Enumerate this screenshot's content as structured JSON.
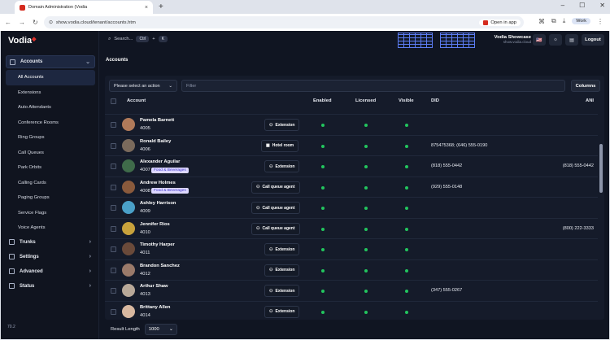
{
  "browser": {
    "tab_title": "Domain Administration (Vodia",
    "url": "show.vodia.cloud/tenant/accounts.htm",
    "open_in_app": "Open in app",
    "profile": "Work"
  },
  "sidebar": {
    "logo": "Vodia",
    "version": "70.2",
    "sections": [
      {
        "label": "Accounts"
      },
      {
        "label": "Trunks"
      },
      {
        "label": "Settings"
      },
      {
        "label": "Advanced"
      },
      {
        "label": "Status"
      }
    ],
    "items": [
      {
        "label": "All Accounts"
      },
      {
        "label": "Extensions"
      },
      {
        "label": "Auto Attendants"
      },
      {
        "label": "Conference Rooms"
      },
      {
        "label": "Ring Groups"
      },
      {
        "label": "Call Queues"
      },
      {
        "label": "Park Orbits"
      },
      {
        "label": "Calling Cards"
      },
      {
        "label": "Paging Groups"
      },
      {
        "label": "Service Flags"
      },
      {
        "label": "Voice Agents"
      }
    ]
  },
  "topbar": {
    "search_label": "Search...",
    "kbd1": "Ctrl",
    "kbd_plus": "+",
    "kbd2": "K",
    "brand": "Vodia Showcase",
    "brand_sub": "show.vodia.cloud",
    "logout": "Logout"
  },
  "page": {
    "title": "Accounts",
    "action_select": "Please select an action",
    "filter_placeholder": "Filter",
    "columns_button": "Columns",
    "result_length_label": "Result Length",
    "result_length_value": "1000"
  },
  "table": {
    "headers": {
      "account": "Account",
      "enabled": "Enabled",
      "licensed": "Licensed",
      "visible": "Visible",
      "did": "DID",
      "ani": "ANI"
    },
    "rows": [
      {
        "name": "Pamela Barnett",
        "ext": "4005",
        "type": "Extension",
        "tag": "",
        "did": "",
        "ani": "",
        "enabled": true,
        "licensed": true,
        "visible": true,
        "avatar": "#b07a5a"
      },
      {
        "name": "Ronald Bailey",
        "ext": "4006",
        "type": "Hotel room",
        "tag": "",
        "did": "875475368; (646) 555-0190",
        "ani": "",
        "enabled": true,
        "licensed": true,
        "visible": true,
        "avatar": "#7a6a5c"
      },
      {
        "name": "Alexander Aguilar",
        "ext": "4007",
        "type": "Extension",
        "tag": "Food & Beverages",
        "did": "(818) 555-0442",
        "ani": "(818) 555-0442",
        "enabled": true,
        "licensed": true,
        "visible": true,
        "avatar": "#3f6b4a"
      },
      {
        "name": "Andrew Holmes",
        "ext": "4008",
        "type": "Call queue agent",
        "tag": "Food & Beverages",
        "did": "(929) 555-0148",
        "ani": "",
        "enabled": true,
        "licensed": true,
        "visible": true,
        "avatar": "#8a5a3c"
      },
      {
        "name": "Ashley Harrison",
        "ext": "4009",
        "type": "Call queue agent",
        "tag": "",
        "did": "",
        "ani": "",
        "enabled": true,
        "licensed": true,
        "visible": true,
        "avatar": "#4aa0c8"
      },
      {
        "name": "Jennifer Rios",
        "ext": "4010",
        "type": "Call queue agent",
        "tag": "",
        "did": "",
        "ani": "(800) 222-3333",
        "enabled": true,
        "licensed": true,
        "visible": true,
        "avatar": "#c8a23c"
      },
      {
        "name": "Timothy Harper",
        "ext": "4011",
        "type": "Extension",
        "tag": "",
        "did": "",
        "ani": "",
        "enabled": true,
        "licensed": true,
        "visible": true,
        "avatar": "#6a4a3a"
      },
      {
        "name": "Brandon Sanchez",
        "ext": "4012",
        "type": "Extension",
        "tag": "",
        "did": "",
        "ani": "",
        "enabled": true,
        "licensed": true,
        "visible": true,
        "avatar": "#9a7a6a"
      },
      {
        "name": "Arthur Shaw",
        "ext": "4013",
        "type": "Extension",
        "tag": "",
        "did": "(347) 555-0267",
        "ani": "",
        "enabled": true,
        "licensed": true,
        "visible": true,
        "avatar": "#b8a898"
      },
      {
        "name": "Brittany Allen",
        "ext": "4014",
        "type": "Extension",
        "tag": "",
        "did": "",
        "ani": "",
        "enabled": true,
        "licensed": true,
        "visible": true,
        "avatar": "#d8b8a0"
      }
    ]
  }
}
